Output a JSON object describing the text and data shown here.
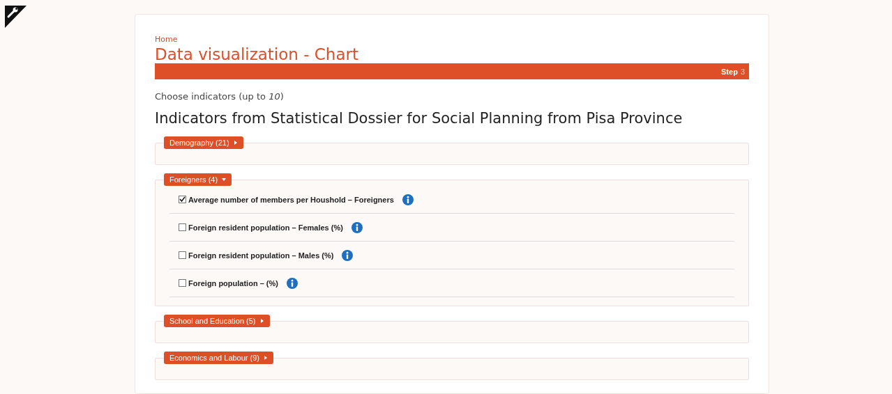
{
  "breadcrumb": "Home",
  "title": "Data visualization - Chart",
  "step": {
    "label": "Step",
    "number": "3"
  },
  "instruction": "Choose indicators (up to *10*)",
  "heading": "Indicators from Statistical Dossier for Social Planning from Pisa Province",
  "groups": [
    {
      "label": "Demography (21)",
      "expanded": false
    },
    {
      "label": "Foreigners (4)",
      "expanded": true,
      "items": [
        {
          "label": "Average number of members per Houshold – Foreigners",
          "checked": true
        },
        {
          "label": "Foreign resident population – Females (%)",
          "checked": false
        },
        {
          "label": "Foreign resident population – Males (%)",
          "checked": false
        },
        {
          "label": "Foreign population – (%)",
          "checked": false
        }
      ]
    },
    {
      "label": "School and Education (5)",
      "expanded": false
    },
    {
      "label": "Economics and Labour (9)",
      "expanded": false
    }
  ]
}
